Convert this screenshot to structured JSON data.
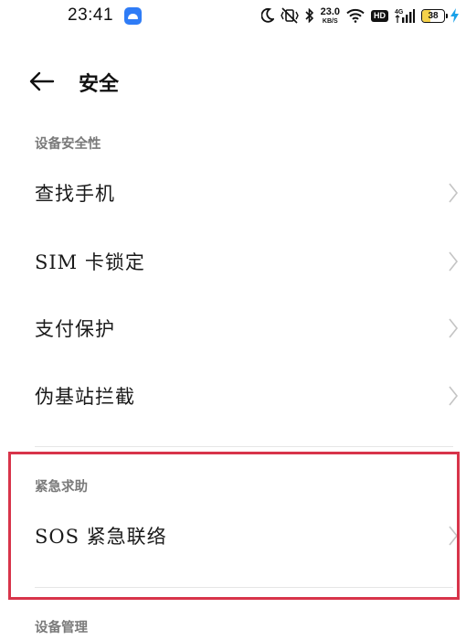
{
  "status_bar": {
    "time": "23:41",
    "net_speed_value": "23.0",
    "net_speed_unit": "KB/S",
    "hd_badge": "HD",
    "network_type": "4G",
    "battery_level": "38",
    "battery_fraction": 0.38,
    "icons": [
      "app-notification-icon",
      "moon-icon",
      "vibrate-icon",
      "bluetooth-icon",
      "wifi-icon",
      "hd-badge",
      "signal-icon",
      "battery-icon",
      "charging-icon"
    ]
  },
  "header": {
    "back_icon": "arrow-left-icon",
    "title": "安全"
  },
  "sections": {
    "device_security": {
      "header": "设备安全性",
      "items": [
        {
          "label": "查找手机"
        },
        {
          "label": "SIM 卡锁定"
        },
        {
          "label": "支付保护"
        },
        {
          "label": "伪基站拦截"
        }
      ]
    },
    "emergency": {
      "header": "紧急求助",
      "items": [
        {
          "label": "SOS 紧急联络"
        }
      ]
    },
    "device_management": {
      "header": "设备管理"
    }
  },
  "colors": {
    "highlight": "#d8344a",
    "app_icon": "#2f7cf6",
    "battery_fill": "#f5d24b",
    "charging": "#1aa1e8",
    "section_header": "#7a7a7a",
    "chevron": "#c4c4c4"
  }
}
